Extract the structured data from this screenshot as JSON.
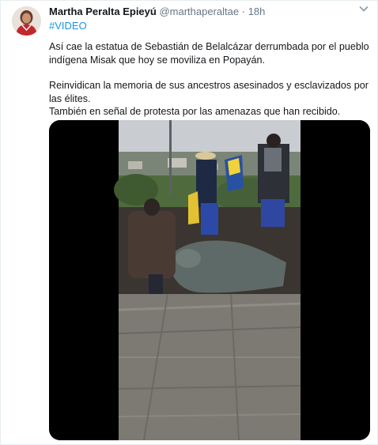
{
  "tweet": {
    "author_name": "Martha Peralta Epieyú",
    "handle": "@marthaperaltae",
    "separator": "·",
    "timestamp": "18h",
    "hashtag": "#VIDEO",
    "paragraphs": [
      "Así cae la estatua de Sebastián de Belalcázar derrumbada por el pueblo indígena Misak que hoy se moviliza en Popayán.",
      "Reinvidican la memoria de sus ancestros asesinados y esclavizados por las élites.",
      "También en señal de protesta por las amenazas que han recibido."
    ]
  },
  "icons": {
    "more_menu": "chevron-down-icon",
    "avatar": "profile-avatar"
  },
  "colors": {
    "name": "#14171a",
    "secondary": "#657786",
    "link": "#1b95e0",
    "border": "#e6ecf0",
    "video_background": "#000000"
  }
}
